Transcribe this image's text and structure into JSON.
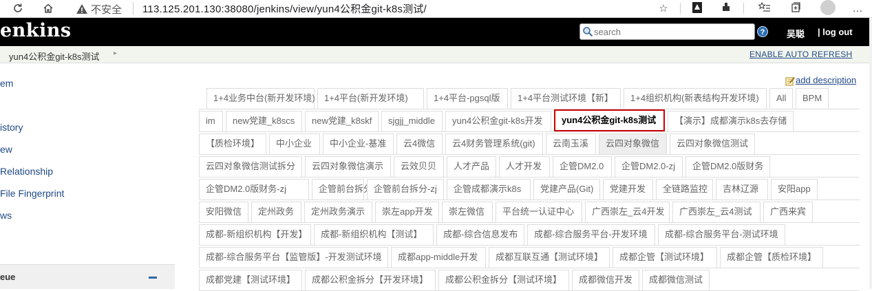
{
  "browser": {
    "insecure_label": "不安全",
    "url": "113.125.201.130:38080/jenkins/view/yun4公积金git-k8s测试/"
  },
  "header": {
    "logo": "enkins",
    "search_placeholder": "search",
    "user": "吴聪",
    "logout": "| log out"
  },
  "breadcrumb": {
    "item": "yun4公积金git-k8s测试",
    "auto_refresh": "ENABLE AUTO REFRESH"
  },
  "sidebar": {
    "items": [
      "em",
      "istory",
      "ew",
      " Relationship",
      "File Fingerprint",
      "ws"
    ],
    "queue_title": "eue"
  },
  "main": {
    "add_description": "add description",
    "tabs": [
      "1+4业务中台(新开发环境)",
      "1+4平台(新开发环境)",
      "1+4平台-pgsql版",
      "1+4平台测试环境【新】",
      "1+4组织机构(新表结构开发环境)",
      "All",
      "BPM",
      "im",
      "new党建_k8scs",
      "new党建_k8skf",
      "sjgjj_middle",
      "yun4公积金git-k8s开发",
      "yun4公积金git-k8s测试",
      "【演示】成都演示k8s去存储",
      "【质检环境】",
      "中小企业",
      "中小企业-基准",
      "云4微信",
      "云4财务管理系统(git)",
      "云南玉溪",
      "云四对象微信",
      "云四对象微信测试",
      "云四对象微信测试拆分",
      "云四对象微信演示",
      "云效贝贝",
      "人才产品",
      "人才开发",
      "企管DM2.0",
      "企管DM2.0-zj",
      "企管DM2.0版财务",
      "企管DM2.0版财务-zj",
      "企管前台拆分",
      "企管前台拆分-zj",
      "企管成都演示k8s",
      "党建产品(Git)",
      "党建开发",
      "全链路监控",
      "吉林辽源",
      "安阳app",
      "安阳微信",
      "定州政务",
      "定州政务演示",
      "崇左app开发",
      "崇左微信",
      "平台统一认证中心",
      "广西崇左_云4开发",
      "广西崇左_云4测试",
      "广西来宾",
      "成都-新组织机构【开发】",
      "成都-新组织机构【测试】",
      "成都-综合信息发布",
      "成都-综合服务平台-开发环境",
      "成都-综合服务平台-测试环境",
      "成都-综合服务平台【监管版】-开发测试环境",
      "成都app-middle开发",
      "成都互联互通【测试环境】",
      "成都企管【测试环境】",
      "成都企管【质检环境】",
      "成都党建【测试环境】",
      "成都公积金拆分【开发环境】",
      "成都公积金拆分【测试环境】",
      "成都微信开发",
      "成都微信测试"
    ],
    "active_tab": "yun4公积金git-k8s测试",
    "shaded_tab": "云四对象微信"
  },
  "colors": {
    "header_bg": "#000000",
    "breadcrumb_bg": "#f2f5ee",
    "link": "#204a87",
    "active_border": "#cc0000"
  }
}
